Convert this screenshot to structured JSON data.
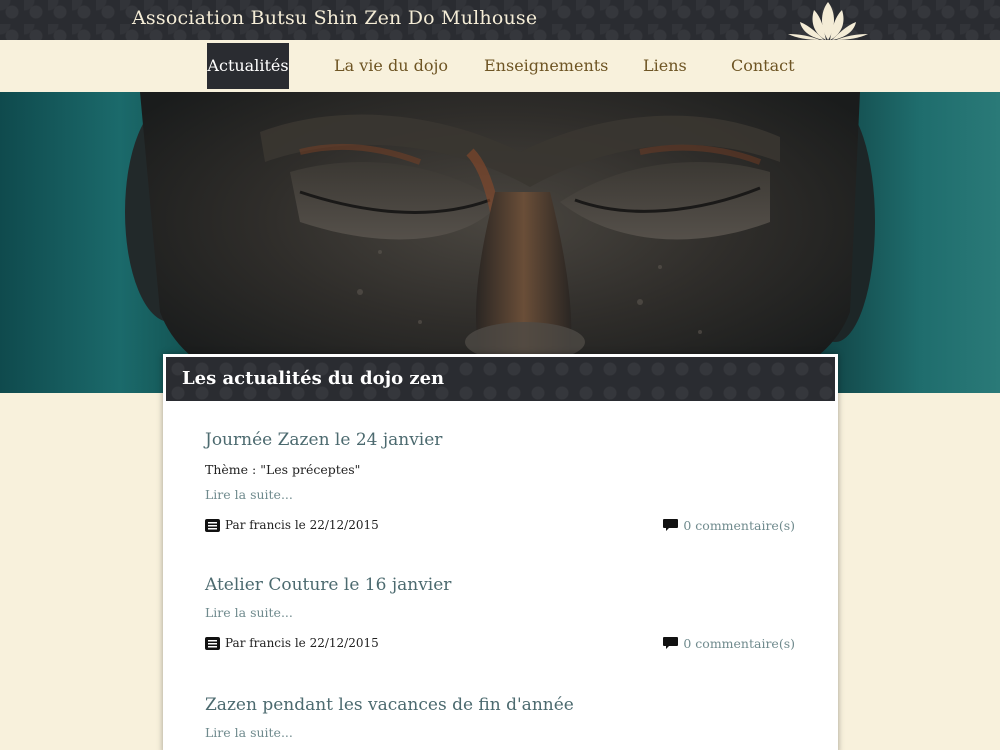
{
  "site": {
    "title": "Association Butsu Shin Zen Do Mulhouse"
  },
  "nav": {
    "items": [
      {
        "label": "Actualités",
        "active": true
      },
      {
        "label": "La vie du dojo",
        "active": false
      },
      {
        "label": "Enseignements",
        "active": false
      },
      {
        "label": "Liens",
        "active": false
      },
      {
        "label": "Contact",
        "active": false
      }
    ]
  },
  "panel": {
    "title": "Les actualités du dojo zen"
  },
  "articles": [
    {
      "title": "Journée Zazen le 24 janvier",
      "excerpt": "Thème : \"Les préceptes\"",
      "read_more": "Lire la suite...",
      "meta": "Par francis le 22/12/2015",
      "comments": "0 commentaire(s)"
    },
    {
      "title": "Atelier Couture le 16 janvier",
      "read_more": "Lire la suite...",
      "meta": "Par francis le 22/12/2015",
      "comments": "0 commentaire(s)"
    },
    {
      "title": "Zazen pendant les vacances de fin d'année",
      "read_more": "Lire la suite..."
    }
  ],
  "colors": {
    "dark": "#2a2c31",
    "cream": "#f8f1dc",
    "nav_text": "#6e5524",
    "article_title": "#4c6a6f",
    "link": "#6f8a8d"
  }
}
